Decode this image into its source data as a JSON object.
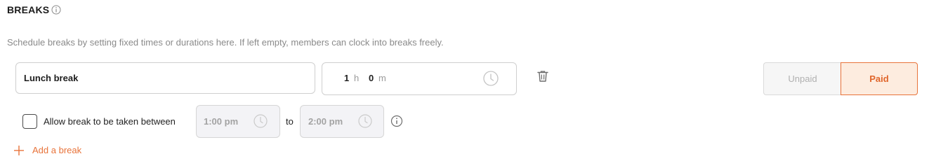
{
  "section": {
    "title": "BREAKS",
    "description": "Schedule breaks by setting fixed times or durations here. If left empty, members can clock into breaks freely."
  },
  "break_row": {
    "name_value": "Lunch break",
    "duration": {
      "hours": "1",
      "hours_unit": "h",
      "minutes": "0",
      "minutes_unit": "m"
    },
    "pay_toggle": {
      "options": [
        "Unpaid",
        "Paid"
      ],
      "selected": "Paid"
    }
  },
  "window_row": {
    "checked": false,
    "label": "Allow break to be taken between",
    "start_time": "1:00 pm",
    "connector": "to",
    "end_time": "2:00 pm"
  },
  "add_break": {
    "label": "Add a break"
  },
  "colors": {
    "accent": "#e8733a",
    "accent_bg": "#fdecdf",
    "muted": "#8a8a8a",
    "border": "#cfcfcf"
  },
  "icons": [
    "info-icon",
    "clock-icon",
    "trash-icon",
    "plus-icon"
  ]
}
